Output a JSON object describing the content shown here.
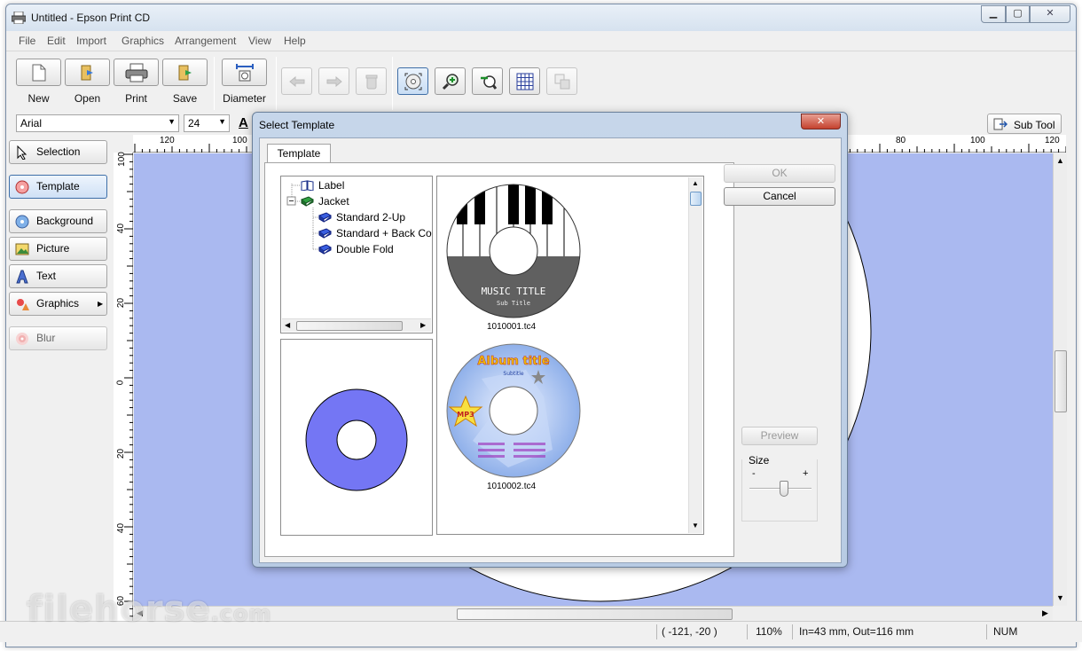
{
  "window": {
    "title": "Untitled - Epson Print CD"
  },
  "menu": [
    "File",
    "Edit",
    "Import",
    "Graphics",
    "Arrangement",
    "View",
    "Help"
  ],
  "toolbar": {
    "new_label": "New",
    "open_label": "Open",
    "print_label": "Print",
    "save_label": "Save",
    "diameter_label": "Diameter"
  },
  "font_bar": {
    "font_name": "Arial",
    "font_size": "24",
    "text_color_glyph": "A",
    "sub_tool_label": "Sub Tool"
  },
  "left_panel": {
    "selection": "Selection",
    "template": "Template",
    "background": "Background",
    "picture": "Picture",
    "text": "Text",
    "graphics": "Graphics",
    "blur": "Blur"
  },
  "rulers": {
    "top": [
      "120",
      "100",
      "80",
      "100",
      "120"
    ],
    "left": [
      "100",
      "40",
      "20",
      "0",
      "20",
      "40",
      "60"
    ]
  },
  "status": {
    "coords": "( -121, -20 )",
    "zoom": "110%",
    "diameter": "In=43 mm, Out=116 mm",
    "num": "NUM"
  },
  "dialog": {
    "title": "Select Template",
    "close_glyph": "✕",
    "tab_label": "Template",
    "tree": [
      {
        "label": "Label",
        "level": 0
      },
      {
        "label": "Jacket",
        "level": 0
      },
      {
        "label": "Standard 2-Up",
        "level": 1
      },
      {
        "label": "Standard + Back Co",
        "level": 1
      },
      {
        "label": "Double Fold",
        "level": 1
      }
    ],
    "templates": [
      {
        "file": "1010001.tc4",
        "title": "MUSIC TITLE",
        "subtitle": "Sub Title"
      },
      {
        "file": "1010002.tc4",
        "title": "Album title",
        "subtitle": "Subtitle",
        "badge": "MP3"
      }
    ],
    "ok_label": "OK",
    "cancel_label": "Cancel",
    "preview_label": "Preview",
    "size_label": "Size",
    "size_minus": "-",
    "size_plus": "+",
    "size_value": 0.55,
    "preview_disc_color": "#7476f4"
  },
  "watermark": {
    "main": "filehorse",
    "suffix": ".com"
  }
}
